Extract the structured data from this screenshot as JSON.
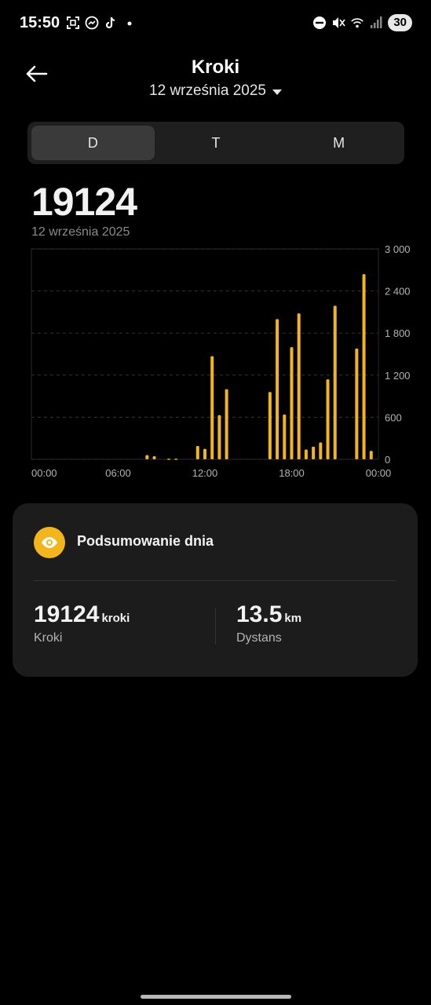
{
  "status_bar": {
    "time": "15:50",
    "left_icons": [
      "screenshot-icon",
      "messenger-icon",
      "tiktok-icon",
      "dot-icon"
    ],
    "right_icons": [
      "do-not-disturb-icon",
      "mute-icon",
      "wifi-icon",
      "signal-icon"
    ],
    "battery": "30"
  },
  "header": {
    "title": "Kroki",
    "date": "12 września 2025"
  },
  "segments": [
    {
      "label": "D",
      "active": true
    },
    {
      "label": "T",
      "active": false
    },
    {
      "label": "M",
      "active": false
    }
  ],
  "summary": {
    "total": "19124",
    "date": "12 września 2025"
  },
  "colors": {
    "accent": "#f2b51b",
    "background": "#000000",
    "card": "#1c1c1c"
  },
  "chart_data": {
    "type": "bar",
    "x_tick_labels": [
      "00:00",
      "06:00",
      "12:00",
      "18:00",
      "00:00"
    ],
    "y_tick_labels": [
      "3 000",
      "2 400",
      "1 800",
      "1 200",
      "600",
      "0"
    ],
    "ylim": [
      0,
      3000
    ],
    "grid": true,
    "units": "steps per interval",
    "bars": [
      {
        "time": "08:00",
        "value": 60
      },
      {
        "time": "08:30",
        "value": 45
      },
      {
        "time": "09:30",
        "value": 10
      },
      {
        "time": "10:00",
        "value": 10
      },
      {
        "time": "11:30",
        "value": 190
      },
      {
        "time": "12:00",
        "value": 150
      },
      {
        "time": "12:30",
        "value": 1470
      },
      {
        "time": "13:00",
        "value": 630
      },
      {
        "time": "13:30",
        "value": 1000
      },
      {
        "time": "16:30",
        "value": 960
      },
      {
        "time": "17:00",
        "value": 2000
      },
      {
        "time": "17:30",
        "value": 640
      },
      {
        "time": "18:00",
        "value": 1600
      },
      {
        "time": "18:30",
        "value": 2080
      },
      {
        "time": "19:00",
        "value": 140
      },
      {
        "time": "19:30",
        "value": 180
      },
      {
        "time": "20:00",
        "value": 240
      },
      {
        "time": "20:30",
        "value": 1140
      },
      {
        "time": "21:00",
        "value": 2190
      },
      {
        "time": "22:30",
        "value": 1580
      },
      {
        "time": "23:00",
        "value": 2640
      },
      {
        "time": "23:30",
        "value": 120
      }
    ]
  },
  "card": {
    "title": "Podsumowanie dnia",
    "icon": "eye-icon",
    "steps": {
      "value": "19124",
      "unit": "kroki",
      "label": "Kroki"
    },
    "distance": {
      "value": "13.5",
      "unit": "km",
      "label": "Dystans"
    }
  }
}
